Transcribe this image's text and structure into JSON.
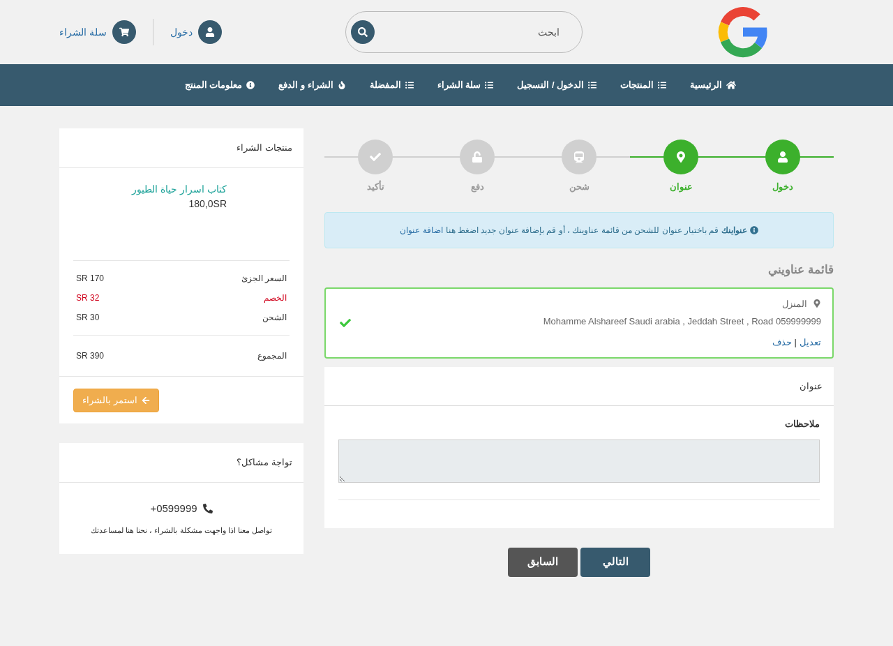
{
  "header": {
    "search": {
      "placeholder": "ابحث"
    },
    "login": "دخول",
    "cart": "سلة الشراء"
  },
  "nav": [
    {
      "label": "الرئيسية",
      "kind": "home"
    },
    {
      "label": "المنتجات",
      "kind": "list"
    },
    {
      "label": "الدخول / التسجيل",
      "kind": "list"
    },
    {
      "label": "سلة الشراء",
      "kind": "list"
    },
    {
      "label": "المفضلة",
      "kind": "list"
    },
    {
      "label": "الشراء و الدفع",
      "kind": "fire"
    },
    {
      "label": "معلومات المنتج",
      "kind": "info"
    }
  ],
  "steps": [
    {
      "label": "دخول",
      "kind": "user",
      "done": true
    },
    {
      "label": "عنوان",
      "kind": "pin",
      "done": true
    },
    {
      "label": "شحن",
      "kind": "train",
      "done": false
    },
    {
      "label": "دفع",
      "kind": "lock",
      "done": false
    },
    {
      "label": "تأكيد",
      "kind": "check",
      "done": false
    }
  ],
  "alert": {
    "text": "**عنواينك** قم باختيار عنوان للشحن من قائمة عناوينك ، أو قم بإضافة عنوان جديد اضغط هنا",
    "link": "اضافة عنوان"
  },
  "addresses_title": "قائمة عناويني",
  "addresses": [
    {
      "name": "المنزل",
      "line": "Mohamme Alshareef Saudi arabia , Jeddah Street , Road 059999999",
      "edit": "تعديل",
      "separator": "|",
      "delete": "حذف",
      "selected": true
    }
  ],
  "form": {
    "header": "عنوان",
    "notes_label": "ملاحظات"
  },
  "buttons": {
    "next": "التالي",
    "previous": "السابق"
  },
  "summary": {
    "title": "منتجات الشراء",
    "product": {
      "name": "كتاب اسرار حياة الطيور",
      "price": "180,0SR"
    },
    "rows": [
      {
        "label": "السعر الجزئ",
        "value": "SR 170",
        "kind": "normal"
      },
      {
        "label": "الخصم",
        "value": "SR 32",
        "kind": "discount"
      },
      {
        "label": "الشحن",
        "value": "SR 30",
        "kind": "normal"
      }
    ],
    "total": {
      "label": "المجموع",
      "value": "SR 390"
    },
    "continue": "استمر بالشراء"
  },
  "help": {
    "title": "تواجة مشاكل؟",
    "phone": "0599999+",
    "text": "تواصل معنا اذا واجهت مشكلة بالشراء ، نحنا هنا لمساعدتك"
  }
}
